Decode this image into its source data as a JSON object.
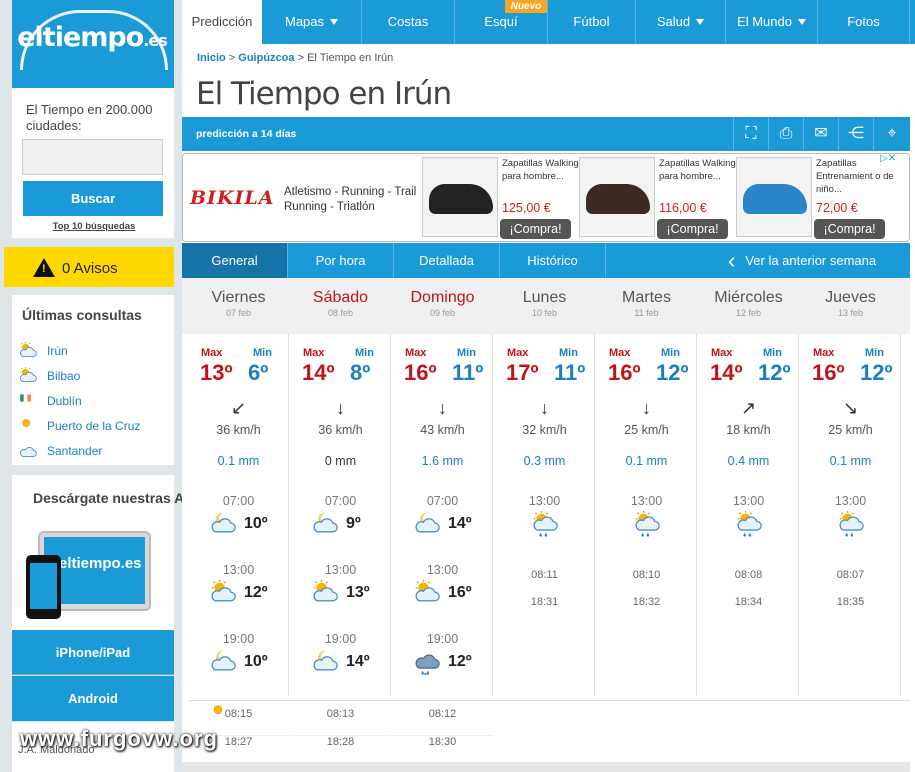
{
  "brand": {
    "logo_main": "eltiempo",
    "logo_ext": ".es"
  },
  "sidebar": {
    "search_title": "El Tiempo en 200.000 ciudades:",
    "search_value": "",
    "search_button": "Buscar",
    "top10": "Top 10 búsquedas",
    "avisos": "0 Avisos",
    "consultas_title": "Últimas consultas",
    "consultas": [
      {
        "label": "Irún",
        "icon": "sun-cloud-icon"
      },
      {
        "label": "Bilbao",
        "icon": "sun-cloud-icon"
      },
      {
        "label": "Dublín",
        "icon": "ireland-flag-icon"
      },
      {
        "label": "Puerto de la Cruz",
        "icon": "sun-icon"
      },
      {
        "label": "Santander",
        "icon": "cloud-icon"
      }
    ],
    "apps_title": "Descárgate nuestras APPs",
    "apps_logo": "eltiempo.es",
    "btn_iphone": "iPhone/iPad",
    "btn_android": "Android",
    "footer_name": "J.A. Maldonado"
  },
  "nav": [
    {
      "label": "Predicción",
      "active": true
    },
    {
      "label": "Mapas",
      "caret": true
    },
    {
      "label": "Costas"
    },
    {
      "label": "Esquí",
      "badge": "Nuevo"
    },
    {
      "label": "Fútbol"
    },
    {
      "label": "Salud",
      "caret": true
    },
    {
      "label": "El Mundo",
      "caret": true
    },
    {
      "label": "Fotos"
    }
  ],
  "breadcrumb": {
    "home": "Inicio",
    "region": "Guipúzcoa",
    "current": "El Tiempo en Irún"
  },
  "page_title": "El Tiempo en Irún",
  "subbar_text": "predicción a 14 días",
  "ad": {
    "brand": "BIKILA",
    "text": "Atletismo - Running - Trail Running - Triatlón",
    "products": [
      {
        "name": "Zapatillas Walking para hombre...",
        "price": "125,00 €",
        "buy": "¡Compra!",
        "color": "#222"
      },
      {
        "name": "Zapatillas Walking para hombre...",
        "price": "116,00 €",
        "buy": "¡Compra!",
        "color": "#3a2a22"
      },
      {
        "name": "Zapatillas Entrenamient o de niño...",
        "price": "72,00 €",
        "buy": "¡Compra!",
        "color": "#2a86c8"
      }
    ]
  },
  "tabs": [
    "General",
    "Por hora",
    "Detallada",
    "Histórico"
  ],
  "prev_week": "Ver la anterior semana",
  "labels": {
    "max": "Max",
    "min": "Min"
  },
  "days": [
    {
      "name": "Viernes",
      "date": "07 feb",
      "max": "13º",
      "min": "6º",
      "wind_dir": "↙",
      "wind": "36 km/h",
      "rain": "0.1 mm",
      "weekend": false,
      "periods": [
        {
          "hour": "07:00",
          "temp": "10º",
          "icon": "moon-cloud-icon"
        },
        {
          "hour": "13:00",
          "temp": "12º",
          "icon": "sun-cloud-icon"
        },
        {
          "hour": "19:00",
          "temp": "10º",
          "icon": "moon-cloud-icon"
        }
      ],
      "sunrise": "08:15",
      "sunset": "18:27"
    },
    {
      "name": "Sábado",
      "date": "08 feb",
      "max": "14º",
      "min": "8º",
      "wind_dir": "↓",
      "wind": "36 km/h",
      "rain": "0 mm",
      "weekend": true,
      "zero": true,
      "periods": [
        {
          "hour": "07:00",
          "temp": "9º",
          "icon": "moon-cloud-icon"
        },
        {
          "hour": "13:00",
          "temp": "13º",
          "icon": "sun-cloud-icon"
        },
        {
          "hour": "19:00",
          "temp": "14º",
          "icon": "moon-cloud-icon"
        }
      ],
      "sunrise": "08:13",
      "sunset": "18:28"
    },
    {
      "name": "Domingo",
      "date": "09 feb",
      "max": "16º",
      "min": "11º",
      "wind_dir": "↓",
      "wind": "43 km/h",
      "rain": "1.6 mm",
      "weekend": true,
      "periods": [
        {
          "hour": "07:00",
          "temp": "14º",
          "icon": "moon-cloud-icon"
        },
        {
          "hour": "13:00",
          "temp": "16º",
          "icon": "sun-cloud-icon"
        },
        {
          "hour": "19:00",
          "temp": "12º",
          "icon": "rain-cloud-icon"
        }
      ],
      "sunrise": "08:12",
      "sunset": "18:30"
    },
    {
      "name": "Lunes",
      "date": "10 feb",
      "max": "17º",
      "min": "11º",
      "wind_dir": "↓",
      "wind": "32 km/h",
      "rain": "0.3 mm",
      "weekend": false,
      "periods": [
        {
          "hour": "13:00",
          "icon": "sun-rain-icon"
        }
      ],
      "sunrise": "08:11",
      "sunset": "18:31"
    },
    {
      "name": "Martes",
      "date": "11 feb",
      "max": "16º",
      "min": "12º",
      "wind_dir": "↓",
      "wind": "25 km/h",
      "rain": "0.1 mm",
      "weekend": false,
      "periods": [
        {
          "hour": "13:00",
          "icon": "sun-rain-icon"
        }
      ],
      "sunrise": "08:10",
      "sunset": "18:32"
    },
    {
      "name": "Miércoles",
      "date": "12 feb",
      "max": "14º",
      "min": "12º",
      "wind_dir": "↗",
      "wind": "18 km/h",
      "rain": "0.4 mm",
      "weekend": false,
      "periods": [
        {
          "hour": "13:00",
          "icon": "sun-rain-icon"
        }
      ],
      "sunrise": "08:08",
      "sunset": "18:34"
    },
    {
      "name": "Jueves",
      "date": "13 feb",
      "max": "16º",
      "min": "12º",
      "wind_dir": "↘",
      "wind": "25 km/h",
      "rain": "0.1 mm",
      "weekend": false,
      "periods": [
        {
          "hour": "13:00",
          "icon": "sun-rain-icon"
        }
      ],
      "sunrise": "08:07",
      "sunset": "18:35"
    }
  ],
  "watermark": "www.furgovw.org",
  "colors": {
    "accent": "#1a9bd7",
    "alert": "#ffd800",
    "max": "#c0141a",
    "min": "#1a7fc0"
  }
}
